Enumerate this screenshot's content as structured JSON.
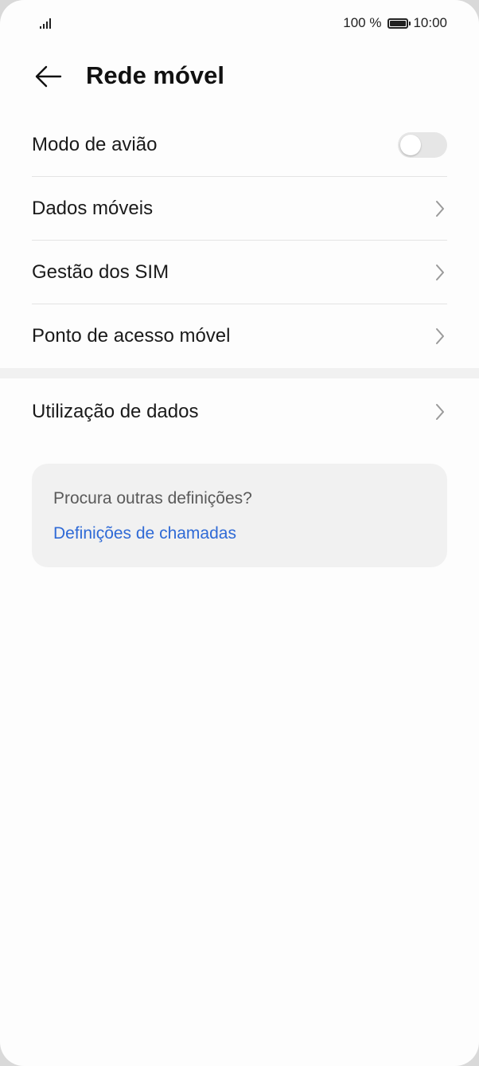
{
  "status_bar": {
    "battery_percent": "100 %",
    "time": "10:00",
    "signal_icon": "signal-icon",
    "battery_icon": "battery-icon"
  },
  "header": {
    "title": "Rede móvel",
    "back_icon": "back-arrow-icon"
  },
  "items": [
    {
      "label": "Modo de avião",
      "control": "toggle",
      "toggle_on": false
    },
    {
      "label": "Dados móveis",
      "control": "chevron"
    },
    {
      "label": "Gestão dos SIM",
      "control": "chevron"
    },
    {
      "label": "Ponto de acesso móvel",
      "control": "chevron"
    },
    {
      "label": "Utilização de dados",
      "control": "chevron"
    }
  ],
  "card": {
    "question": "Procura outras definições?",
    "link": "Definições de chamadas"
  },
  "colors": {
    "link": "#2f6ad6",
    "background": "#fdfdfd",
    "card_bg": "#f1f1f1"
  }
}
